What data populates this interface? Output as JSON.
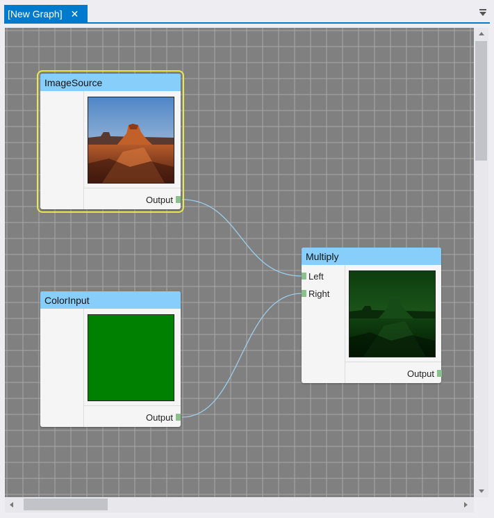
{
  "tab": {
    "title": "[New Graph]",
    "close_glyph": "✕"
  },
  "icons": {
    "tab_menu": "dropdown-menu-icon",
    "tab_close": "close-icon"
  },
  "colors": {
    "accent": "#007acc",
    "node_header": "#87cefa",
    "selection": "#e7e84a",
    "wire": "#9ccfee",
    "port": "#8bbf8b",
    "color_input_value": "#008000"
  },
  "nodes": {
    "image_source": {
      "title": "ImageSource",
      "output_label": "Output",
      "selected": true
    },
    "color_input": {
      "title": "ColorInput",
      "output_label": "Output",
      "color": "#008000"
    },
    "multiply": {
      "title": "Multiply",
      "left_label": "Left",
      "right_label": "Right",
      "output_label": "Output"
    }
  },
  "connections": [
    {
      "from": "ImageSource.Output",
      "to": "Multiply.Left"
    },
    {
      "from": "ColorInput.Output",
      "to": "Multiply.Right"
    }
  ]
}
